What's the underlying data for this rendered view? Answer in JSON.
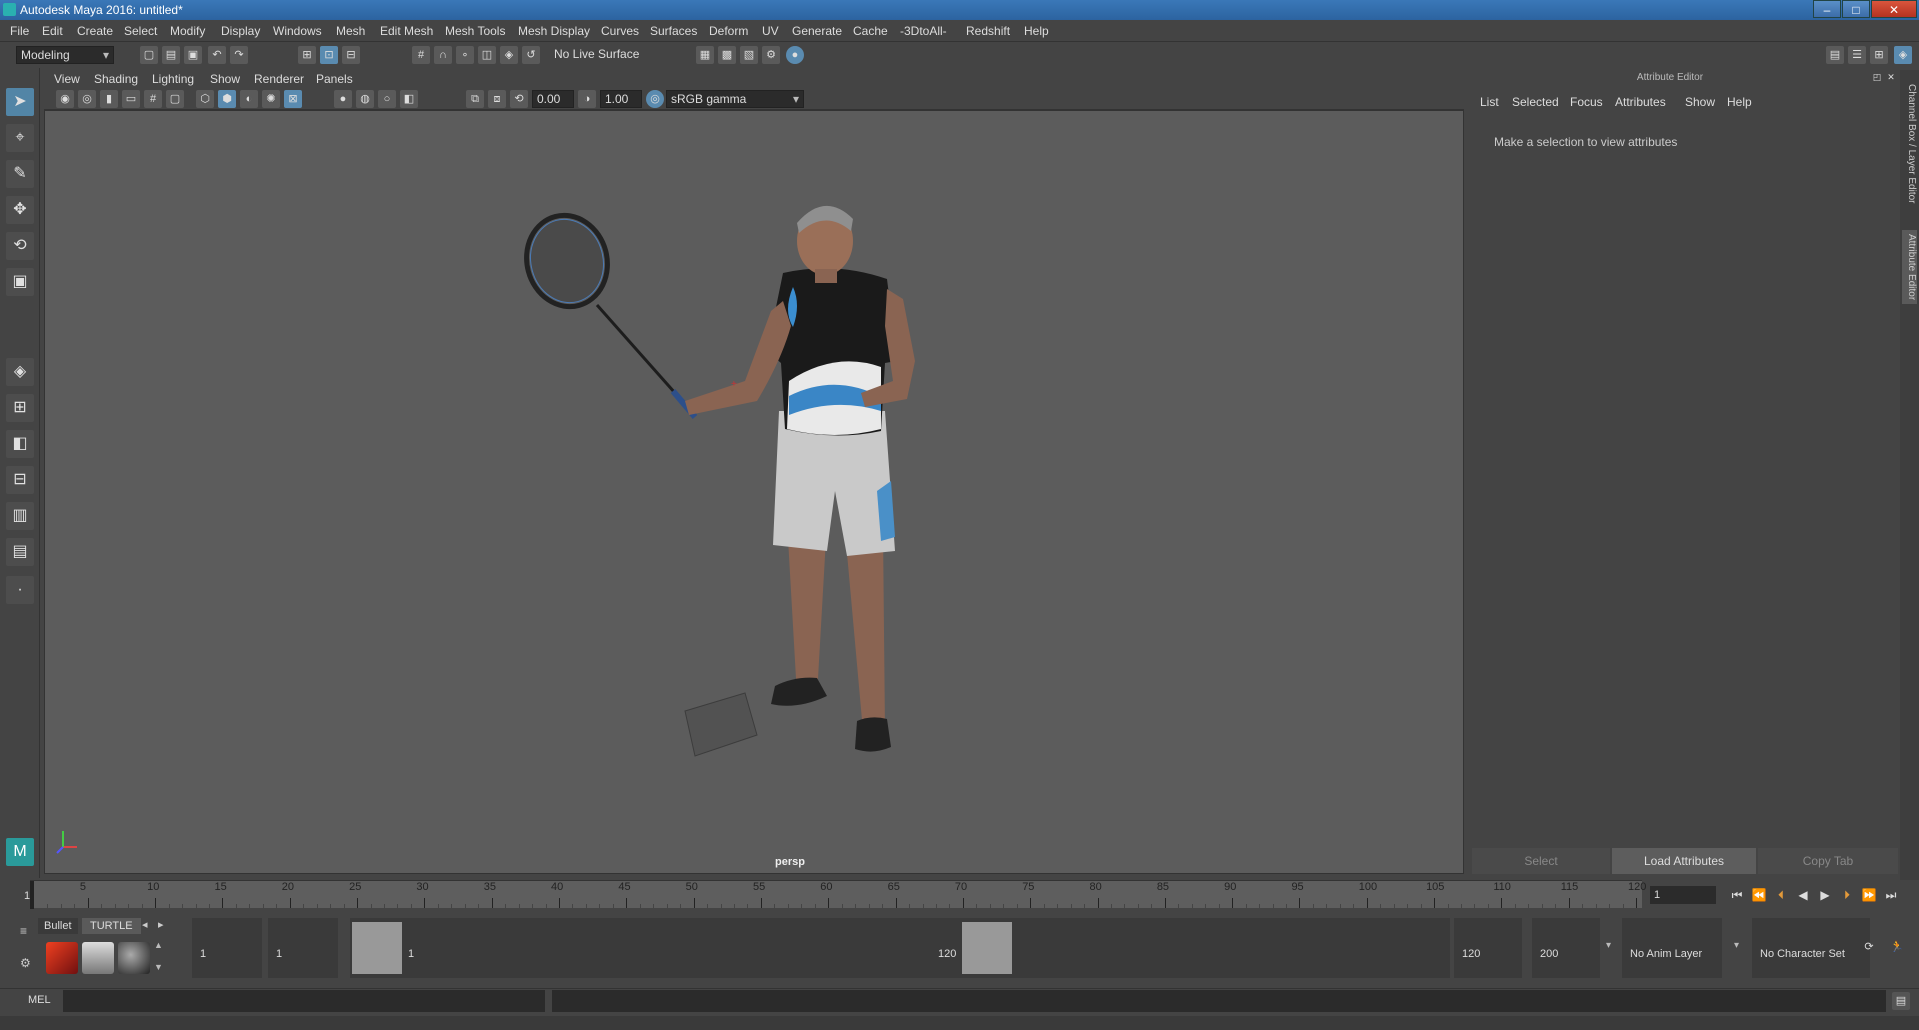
{
  "window": {
    "title": "Autodesk Maya 2016: untitled*",
    "minimize": "–",
    "maximize": "□",
    "close": "✕"
  },
  "menu": [
    "File",
    "Edit",
    "Create",
    "Select",
    "Modify",
    "Display",
    "Windows",
    "Mesh",
    "Edit Mesh",
    "Mesh Tools",
    "Mesh Display",
    "Curves",
    "Surfaces",
    "Deform",
    "UV",
    "Generate",
    "Cache",
    "-3DtoAll-",
    "Redshift",
    "Help"
  ],
  "statusline": {
    "mode": "Modeling",
    "live_surface": "No Live Surface"
  },
  "panel": {
    "menu": [
      "View",
      "Shading",
      "Lighting",
      "Show",
      "Renderer",
      "Panels"
    ],
    "exposure": "0.00",
    "gamma": "1.00",
    "color_space": "sRGB gamma",
    "camera_label": "persp"
  },
  "attribute_editor": {
    "title": "Attribute Editor",
    "menu": [
      "List",
      "Selected",
      "Focus",
      "Attributes",
      "Show",
      "Help"
    ],
    "message": "Make a selection to view attributes",
    "buttons": {
      "select": "Select",
      "load": "Load Attributes",
      "copy": "Copy Tab"
    },
    "side_tabs": {
      "channel_box": "Channel Box / Layer Editor",
      "attr_editor": "Attribute Editor"
    }
  },
  "timeline": {
    "ticks": [
      5,
      10,
      15,
      20,
      25,
      30,
      35,
      40,
      45,
      50,
      55,
      60,
      65,
      70,
      75,
      80,
      85,
      90,
      95,
      100,
      105,
      110,
      115,
      120
    ],
    "start_label": "1",
    "current_frame": "1"
  },
  "range": {
    "start_field": "1",
    "playback_start": "1",
    "range_start": "1",
    "range_end": "120",
    "playback_end": "120",
    "end_field": "200",
    "anim_layer": "No Anim Layer",
    "character_set": "No Character Set"
  },
  "shelf": {
    "tab1": "Bullet",
    "tab2": "TURTLE"
  },
  "command": {
    "lang": "MEL"
  }
}
